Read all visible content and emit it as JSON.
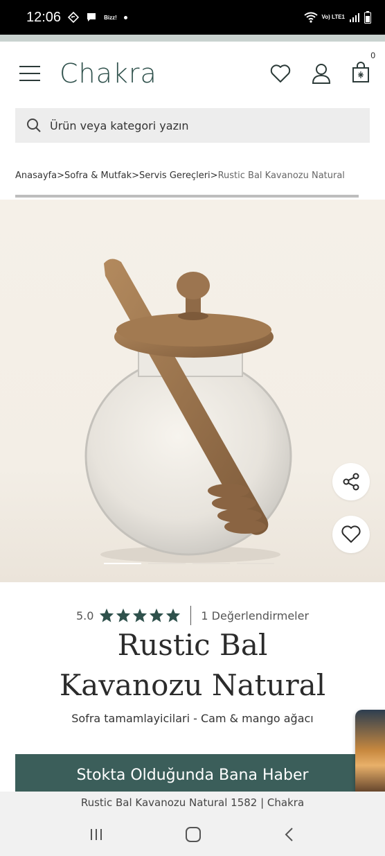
{
  "status_bar": {
    "time": "12:06",
    "notification_text": "Bizz!",
    "network": "Vo) LTE1"
  },
  "header": {
    "logo": "Chakra",
    "cart_count": "0"
  },
  "search": {
    "placeholder": "Ürün veya kategori yazın"
  },
  "breadcrumb": {
    "items": [
      "Anasayfa",
      "Sofra & Mutfak",
      "Servis Gereçleri"
    ],
    "separator": ">",
    "current": "Rustic Bal Kavanozu Natural"
  },
  "product": {
    "rating": "5.0",
    "star_count": 5,
    "reviews": "1 Değerlendirmeler",
    "title_line1": "Rustic Bal",
    "title_line2": "Kavanozu Natural",
    "subtitle": "Sofra tamamlayicilari - Cam & mango ağacı",
    "cta": "Stokta Olduğunda Bana Haber"
  },
  "gallery": {
    "slide_count": 4,
    "active_slide": 1
  },
  "browser": {
    "page_title": "Rustic Bal Kavanozu Natural 1582 | Chakra"
  },
  "colors": {
    "brand": "#2f514c",
    "cta_background": "#3b5e5a",
    "star": "#2f514c"
  }
}
